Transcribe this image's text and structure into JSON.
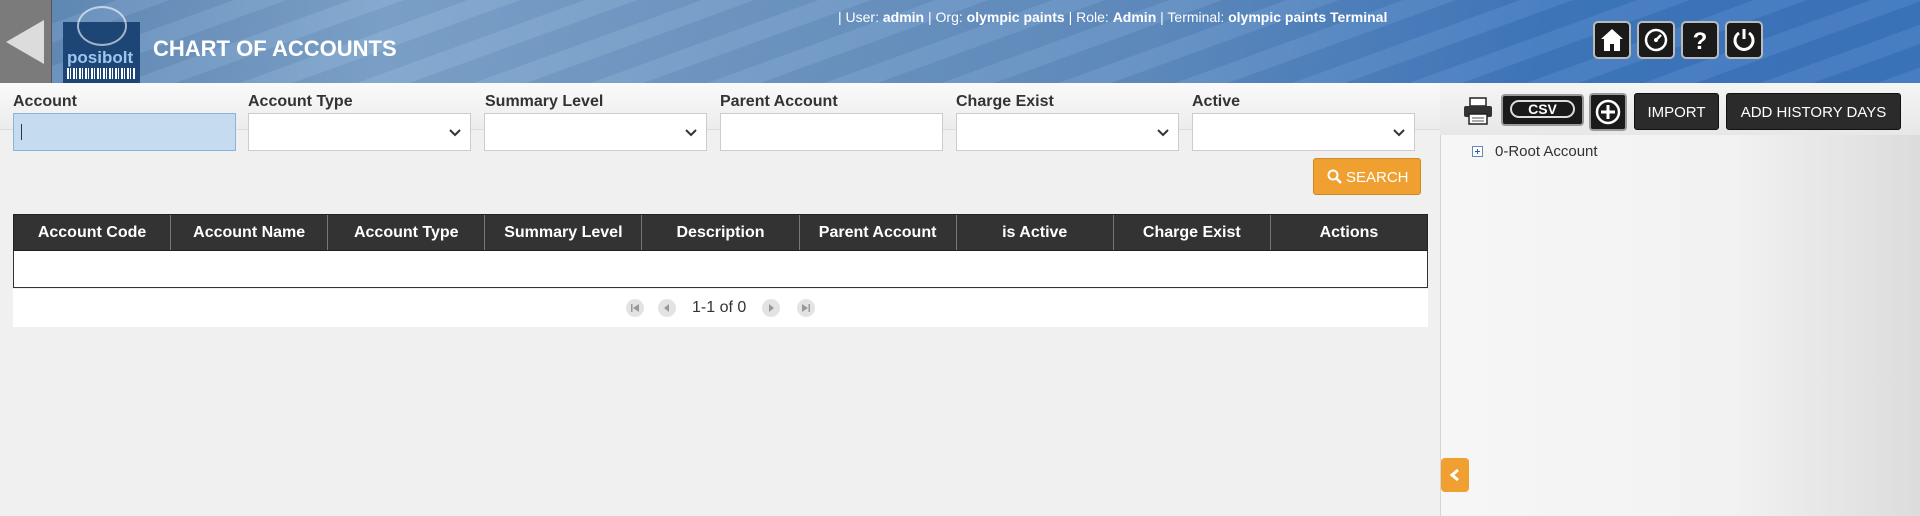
{
  "header": {
    "title": "CHART OF ACCOUNTS",
    "logo_text": "posibolt",
    "user_prefix": "| User:",
    "user": "admin",
    "org_prefix": "| Org:",
    "org": "olympic paints",
    "role_prefix": "| Role:",
    "role": "Admin",
    "terminal_prefix": "| Terminal:",
    "terminal": "olympic paints Terminal",
    "icons": [
      "home-icon",
      "dashboard-icon",
      "help-icon",
      "power-icon"
    ]
  },
  "filters": {
    "account": {
      "label": "Account",
      "value": ""
    },
    "account_type": {
      "label": "Account Type",
      "value": ""
    },
    "summary_level": {
      "label": "Summary Level",
      "value": ""
    },
    "parent_account": {
      "label": "Parent Account",
      "value": ""
    },
    "charge_exist": {
      "label": "Charge Exist",
      "value": ""
    },
    "active": {
      "label": "Active",
      "value": ""
    },
    "search_label": "SEARCH"
  },
  "table": {
    "columns": [
      "Account Code",
      "Account Name",
      "Account Type",
      "Summary Level",
      "Description",
      "Parent Account",
      "is Active",
      "Charge Exist",
      "Actions"
    ],
    "rows": []
  },
  "pager": {
    "text": "1-1 of 0"
  },
  "right_panel": {
    "csv_label": "CSV",
    "import_label": "IMPORT",
    "history_label": "ADD HISTORY DAYS",
    "tree": [
      {
        "label": "0-Root Account"
      }
    ]
  },
  "colors": {
    "accent": "#f0a030",
    "header": "#4a80c0",
    "dark": "#333333"
  }
}
